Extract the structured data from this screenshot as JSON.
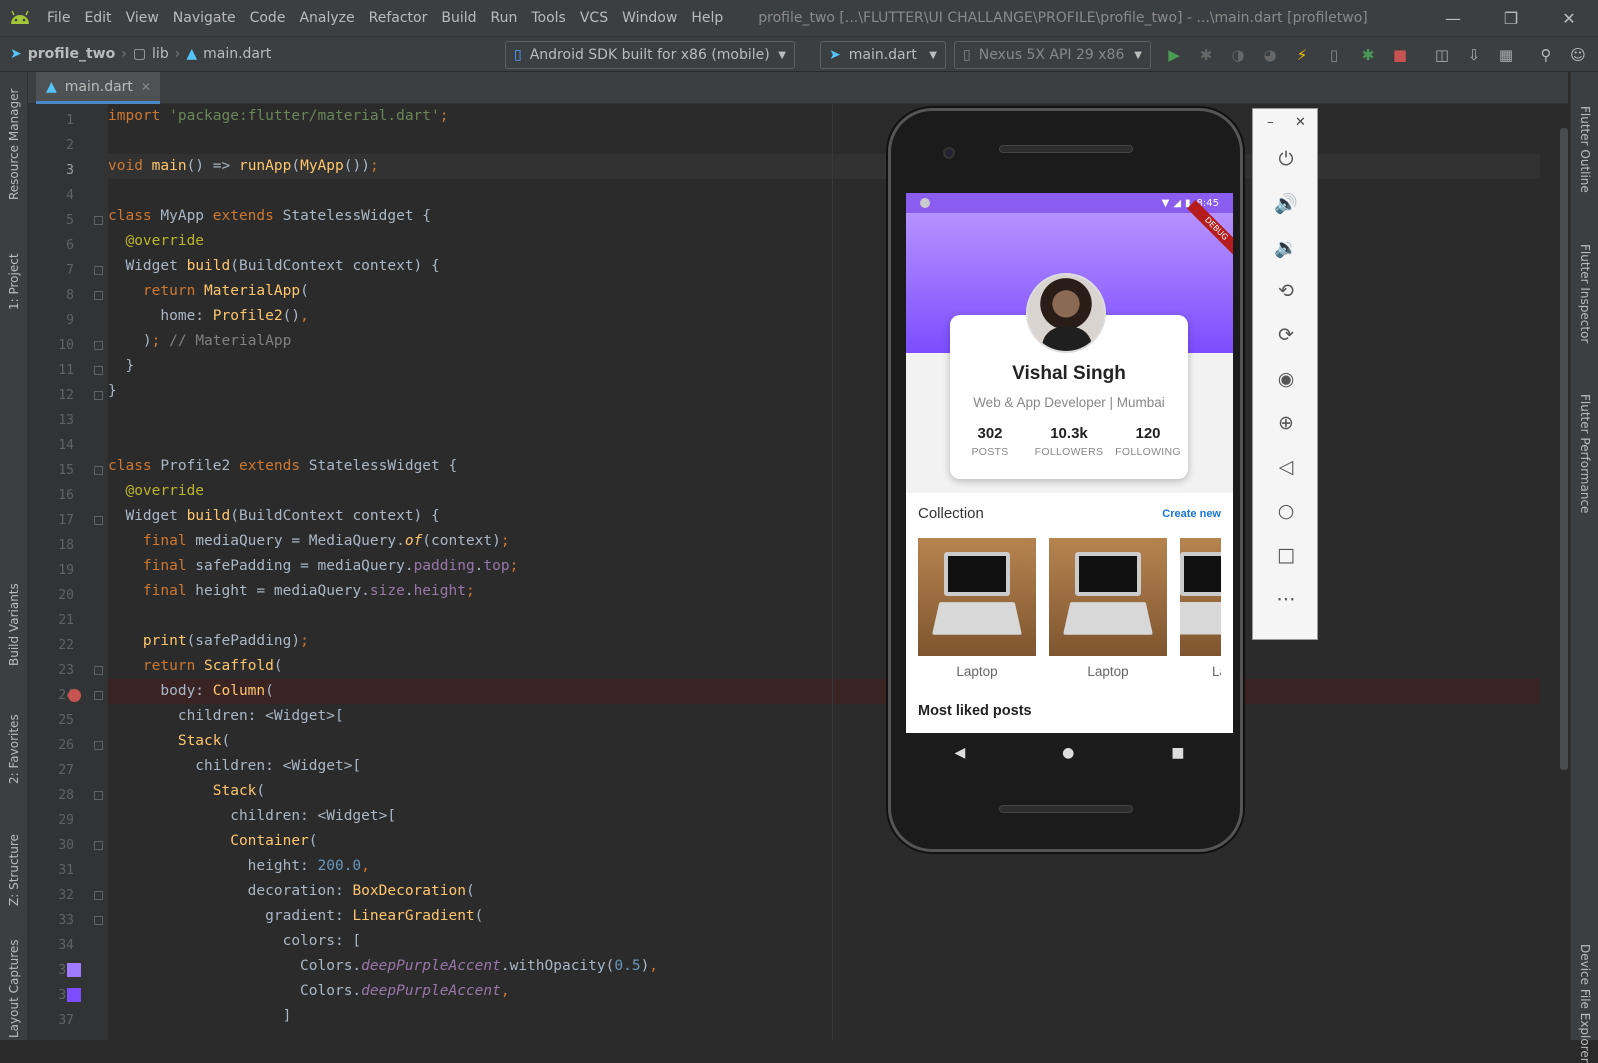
{
  "titlebar": {
    "menu": [
      "File",
      "Edit",
      "View",
      "Navigate",
      "Code",
      "Analyze",
      "Refactor",
      "Build",
      "Run",
      "Tools",
      "VCS",
      "Window",
      "Help"
    ],
    "window_title": "profile_two [...\\FLUTTER\\UI CHALLANGE\\PROFILE\\profile_two] - ...\\main.dart [profiletwo]"
  },
  "navbar": {
    "breadcrumb": [
      "profile_two",
      "lib",
      "main.dart"
    ],
    "device_selector": "Android SDK built for x86 (mobile)",
    "run_config": "main.dart",
    "avd": "Nexus 5X API 29 x86"
  },
  "editor": {
    "tab_label": "main.dart",
    "left_tool_tabs": [
      "Resource Manager",
      "1: Project",
      "Build Variants",
      "2: Favorites",
      "Z: Structure",
      "Layout Captures"
    ],
    "right_tool_tabs": [
      "Flutter Outline",
      "Flutter Inspector",
      "Flutter Performance",
      "Device File Explorer"
    ],
    "line_numbers": [
      "1",
      "2",
      "3",
      "4",
      "5",
      "6",
      "7",
      "8",
      "9",
      "10",
      "11",
      "12",
      "13",
      "14",
      "15",
      "16",
      "17",
      "18",
      "19",
      "20",
      "21",
      "22",
      "23",
      "24",
      "25",
      "26",
      "27",
      "28",
      "29",
      "30",
      "31",
      "32",
      "33",
      "34",
      "35",
      "36",
      "37"
    ]
  },
  "app": {
    "status_time": "8:45",
    "debug_banner": "DEBUG",
    "profile_name": "Vishal Singh",
    "profile_subtitle": "Web & App Developer | Mumbai",
    "stats": [
      {
        "value": "302",
        "label": "POSTS"
      },
      {
        "value": "10.3k",
        "label": "FOLLOWERS"
      },
      {
        "value": "120",
        "label": "FOLLOWING"
      }
    ],
    "collection_title": "Collection",
    "create_new": "Create new",
    "collection_items": [
      "Laptop",
      "Laptop",
      "Laptop"
    ],
    "most_liked": "Most liked posts"
  },
  "emulator_toolbar": {
    "buttons": [
      "power-icon",
      "volume-up-icon",
      "volume-down-icon",
      "rotate-left-icon",
      "rotate-right-icon",
      "camera-icon",
      "zoom-icon",
      "back-icon",
      "home-icon",
      "overview-icon",
      "more-icon"
    ]
  },
  "colors": {
    "accent_purple": "#7c4dff",
    "link_blue": "#1976d2",
    "run_green": "#499c54"
  }
}
